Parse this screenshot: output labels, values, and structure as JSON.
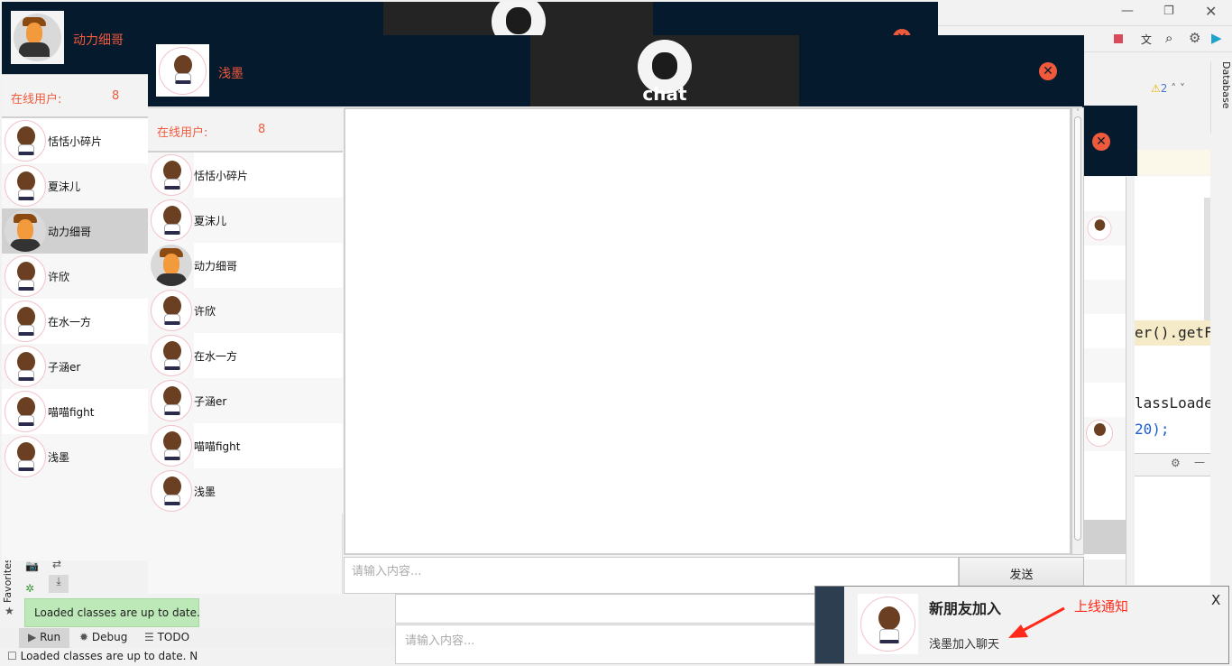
{
  "ide": {
    "code_lines": [
      "er().getF",
      "lassLoade",
      "20);"
    ],
    "warning_count": "2",
    "database_label": "Database",
    "favorites_label": "Favorites",
    "tabs": [
      {
        "label": "Run"
      },
      {
        "label": "Debug"
      },
      {
        "label": "TODO"
      }
    ],
    "tooltip": "Loaded classes are up to date.",
    "status": "Loaded classes are up to date. N"
  },
  "window_back": {
    "user_name": "动力细哥",
    "online_label": "在线用户:",
    "online_count": "8",
    "input_placeholder": "请输入内容..."
  },
  "window_front": {
    "user_name": "浅墨",
    "logo_text": "chat",
    "online_label": "在线用户:",
    "online_count": "8",
    "input_placeholder": "请输入内容...",
    "send_label": "发送"
  },
  "users": [
    {
      "name": "恬恬小碎片",
      "avatar": "girl"
    },
    {
      "name": "夏沫儿",
      "avatar": "girl"
    },
    {
      "name": "动力细哥",
      "avatar": "man"
    },
    {
      "name": "许欣",
      "avatar": "girl"
    },
    {
      "name": "在水一方",
      "avatar": "girl"
    },
    {
      "name": "子涵er",
      "avatar": "girl"
    },
    {
      "name": "喵喵fight",
      "avatar": "girl"
    },
    {
      "name": "浅墨",
      "avatar": "girl"
    }
  ],
  "notification": {
    "title": "新朋友加入",
    "message": "浅墨加入聊天",
    "close_label": "X",
    "annotation": "上线通知",
    "accent": "#2c3e50"
  }
}
